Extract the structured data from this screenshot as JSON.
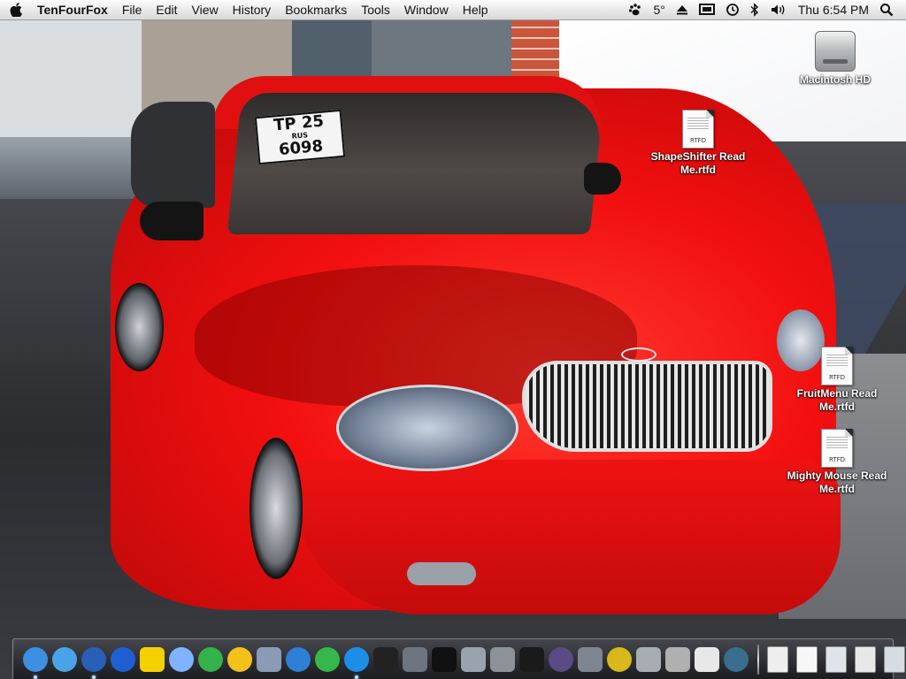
{
  "menubar": {
    "app_name": "TenFourFox",
    "menus": [
      "File",
      "Edit",
      "View",
      "History",
      "Bookmarks",
      "Tools",
      "Window",
      "Help"
    ],
    "status": {
      "temperature": "5°",
      "clock": "Thu 6:54 PM"
    }
  },
  "wallpaper": {
    "plate_top": "TP 25",
    "plate_region": "RUS",
    "plate_bottom": "6098"
  },
  "desktop_icons": [
    {
      "label": "Macintosh HD",
      "icon": "hard-drive-icon"
    },
    {
      "label": "ShapeShifter Read Me.rtfd",
      "icon": "rtfd-document-icon",
      "tag": "RTFD"
    },
    {
      "label": "FruitMenu Read Me.rtfd",
      "icon": "rtfd-document-icon",
      "tag": "RTFD"
    },
    {
      "label": "Mighty Mouse Read Me.rtfd",
      "icon": "rtfd-document-icon",
      "tag": "RTFD"
    }
  ],
  "dock": {
    "apps": [
      {
        "name": "finder-icon",
        "color": "#3d8fe0",
        "running": true
      },
      {
        "name": "safari-icon",
        "color": "#4aa3e8",
        "running": false
      },
      {
        "name": "tenfourfox-icon",
        "color": "#2a5fb8",
        "running": true
      },
      {
        "name": "camino-icon",
        "color": "#1e60d4",
        "running": false
      },
      {
        "name": "aim-icon",
        "color": "#f5d000",
        "running": false
      },
      {
        "name": "ichat-icon",
        "color": "#7fb3ff",
        "running": false
      },
      {
        "name": "skype-icon",
        "color": "#33b34a",
        "running": false
      },
      {
        "name": "adium-icon",
        "color": "#f3c21a",
        "running": false
      },
      {
        "name": "iphoto-icon",
        "color": "#8a9bb5",
        "running": false
      },
      {
        "name": "itunes-icon",
        "color": "#2e7fd6",
        "running": false
      },
      {
        "name": "spotify-icon",
        "color": "#35b849",
        "running": false
      },
      {
        "name": "quicktime-icon",
        "color": "#1d8ee8",
        "running": true
      },
      {
        "name": "media-player-icon",
        "color": "#222222",
        "running": false
      },
      {
        "name": "screen-sharing-icon",
        "color": "#6c7580",
        "running": false
      },
      {
        "name": "activity-monitor-icon",
        "color": "#111111",
        "running": false
      },
      {
        "name": "iscsi-icon",
        "color": "#9aa3ad",
        "running": false
      },
      {
        "name": "system-preferences-icon",
        "color": "#8d9299",
        "running": false
      },
      {
        "name": "terminal-icon",
        "color": "#1a1a1a",
        "running": false
      },
      {
        "name": "mac-os-x-icon",
        "color": "#5a4b86",
        "running": false
      },
      {
        "name": "utilities-icon",
        "color": "#7d8590",
        "running": false
      },
      {
        "name": "gear-disk-icon",
        "color": "#d9b81a",
        "running": false
      },
      {
        "name": "tool-icon",
        "color": "#a8adb3",
        "running": false
      },
      {
        "name": "x11-icon",
        "color": "#b0b0b0",
        "running": false
      },
      {
        "name": "airport-icon",
        "color": "#e8e8e8",
        "running": false
      },
      {
        "name": "spiral-icon",
        "color": "#3a6d8e",
        "running": false
      }
    ],
    "docs": [
      {
        "name": "document-icon-1",
        "color": "#eeeeee"
      },
      {
        "name": "document-icon-2",
        "color": "#f7f7f7"
      },
      {
        "name": "window-icon-1",
        "color": "#dfe4ea"
      },
      {
        "name": "window-icon-2",
        "color": "#e8e8e8"
      },
      {
        "name": "window-icon-3",
        "color": "#d7dce2"
      },
      {
        "name": "trash-icon",
        "color": "#9ea3a8"
      }
    ]
  }
}
